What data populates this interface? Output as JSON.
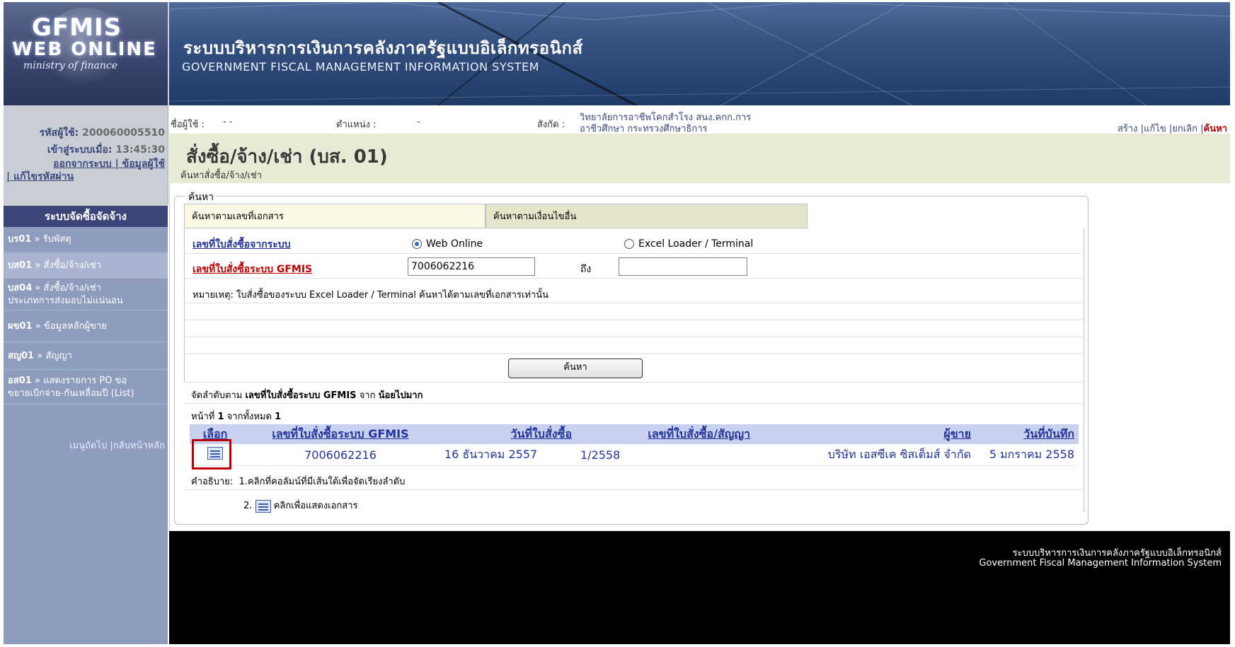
{
  "header": {
    "logo_line1": "GFMIS",
    "logo_line2": "WEB ONLINE",
    "logo_line3": "ministry of finance",
    "system_name_th": "ระบบบริหารการเงินการคลังภาครัฐแบบอิเล็กทรอนิกส์",
    "system_name_en": "GOVERNMENT FISCAL MANAGEMENT INFORMATION SYSTEM"
  },
  "user_panel": {
    "user_id_label": "รหัสผู้ใช้:",
    "user_id": "200060005510",
    "login_label": "เข้าสู่ระบบเมื่อ:",
    "login_time": "13:45:30",
    "logout_link": "ออกจากระบบ",
    "userinfo_link": "ข้อมูลผู้ใช้",
    "change_password_link": "แก้ไขรหัสผ่าน"
  },
  "sidebar": {
    "heading": "ระบบจัดซื้อจัดจ้าง",
    "items": [
      {
        "code": "บร01",
        "label": "รับพัสดุ"
      },
      {
        "code": "บส01",
        "label": "สั่งซื้อ/จ้าง/เช่า"
      },
      {
        "code": "บส04",
        "label": "สั่งซื้อ/จ้าง/เช่า",
        "label2": "ประเภทการส่งมอบไม่แน่นอน"
      },
      {
        "code": "ผข01",
        "label": "ข้อมูลหลักผู้ขาย"
      },
      {
        "code": "สญ01",
        "label": "สัญญา"
      },
      {
        "code": "อส01",
        "label": "แสดงรายการ PO ขอ",
        "label2": "ขยายเบิกจ่าย-กันเหลื่อมปี (List)"
      }
    ],
    "sep": "»",
    "footer_next": "เมนูถัดไป",
    "footer_home": "กลับหน้าหลัก"
  },
  "infobar": {
    "username_label": "ชื่อผู้ใช้ :",
    "username_value": "- -",
    "position_label": "ตำแหน่ง :",
    "position_value": "-",
    "dept_label": "สังกัด :",
    "dept_line1": "วิทยาลัยการอาชีพโคกสำโรง สนง.คกก.การ",
    "dept_line2": "อาชีวศึกษา กระทรวงศึกษาธิการ",
    "actions": [
      "สร้าง",
      "แก้ไข",
      "ยกเลิก",
      "ค้นหา"
    ]
  },
  "page": {
    "title": "สั่งซื้อ/จ้าง/เช่า (บส. 01)",
    "subtitle": "ค้นหาสั่งซื้อ/จ้าง/เช่า"
  },
  "search": {
    "legend": "ค้นหา",
    "tab_doc": "ค้นหาตามเลขที่เอกสาร",
    "tab_other": "ค้นหาตามเงื่อนไขอื่น",
    "po_system_label": "เลขที่ใบสั่งซื้อจากระบบ",
    "radio_web": "Web Online",
    "radio_excel": "Excel Loader / Terminal",
    "po_gfmis_label": "เลขที่ใบสั่งซื้อระบบ GFMIS",
    "po_from": "7006062216",
    "to_label": "ถึง",
    "po_to": "",
    "note": "หมายเหตุ: ใบสั่งซื้อของระบบ Excel Loader / Terminal ค้นหาได้ตามเลขที่เอกสารเท่านั้น",
    "button": "ค้นหา"
  },
  "results": {
    "sort_prefix": "จัดลำดับตาม",
    "sort_field": "เลขที่ใบสั่งซื้อระบบ GFMIS",
    "sort_from": "จาก",
    "sort_order": "น้อยไปมาก",
    "page_prefix": "หน้าที่",
    "page_num": "1",
    "page_mid": "จากทั้งหมด",
    "page_total": "1",
    "columns": [
      "เลือก",
      "เลขที่ใบสั่งซื้อระบบ GFMIS",
      "วันที่ใบสั่งซื้อ",
      "เลขที่ใบสั่งซื้อ/สัญญา",
      "ผู้ขาย",
      "วันที่บันทึก"
    ],
    "rows": [
      {
        "icon": "document-icon",
        "po_gfmis": "7006062216",
        "po_date": "16 ธันวาคม 2557",
        "po_contract": "1/2558",
        "vendor": "บริษัท เอสซีเค ซิสเต็มส์ จำกัด",
        "record_date": "5 มกราคม 2558"
      }
    ],
    "legend_label": "คำอธิบาย:",
    "legend1": "1.คลิกที่คอลัมน์ที่มีเส้นใต้เพื่อจัดเรียงลำดับ",
    "legend2_num": "2.",
    "legend2": "คลิกเพื่อแสดงเอกสาร"
  },
  "footer": {
    "line_th": "ระบบบริหารการเงินการคลังภาครัฐแบบอิเล็กทรอนิกส์",
    "line_en": "Government Fiscal Management Information System"
  }
}
